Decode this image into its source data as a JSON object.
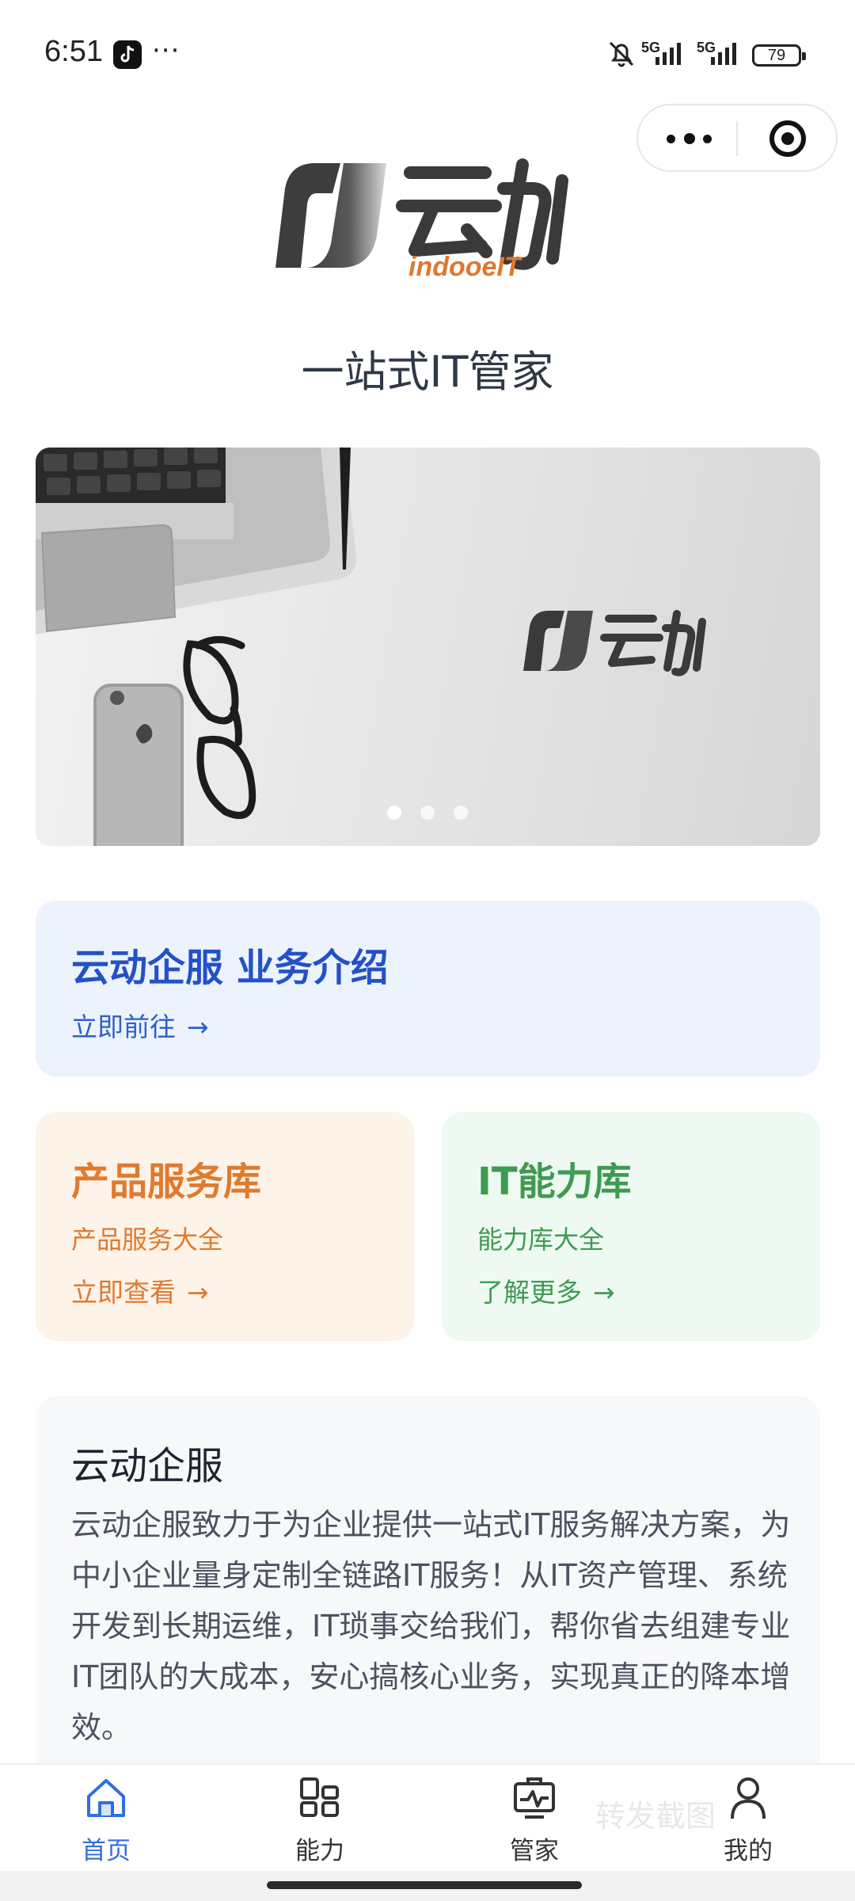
{
  "status_bar": {
    "time": "6:51",
    "overflow": "···",
    "network_1": "5G",
    "network_2": "5G",
    "battery": "79"
  },
  "header": {
    "logo_text": "云动",
    "logo_subtext": "indooeIT",
    "slogan": "一站式IT管家"
  },
  "banner": {
    "logo_text": "云动",
    "slides": 3,
    "active_slide": 0
  },
  "cards": {
    "intro": {
      "title": "云动企服 业务介绍",
      "link": "立即前往"
    },
    "product": {
      "title": "产品服务库",
      "subtitle": "产品服务大全",
      "link": "立即查看"
    },
    "it": {
      "title": "IT能力库",
      "subtitle": "能力库大全",
      "link": "了解更多"
    },
    "about": {
      "title": "云动企服",
      "body": "云动企服致力于为企业提供一站式IT服务解决方案，为中小企业量身定制全链路IT服务！从IT资产管理、系统开发到长期运维，IT琐事交给我们，帮你省去组建专业IT团队的大成本，安心搞核心业务，实现真正的降本增效。"
    }
  },
  "watermark": "转发截图",
  "tabbar": [
    {
      "label": "首页",
      "icon": "home-icon",
      "active": true
    },
    {
      "label": "能力",
      "icon": "grid-icon",
      "active": false
    },
    {
      "label": "管家",
      "icon": "monitor-icon",
      "active": false
    },
    {
      "label": "我的",
      "icon": "user-icon",
      "active": false
    }
  ],
  "colors": {
    "accent": "#2f6fe0",
    "intro_bg": "#ecf3fd",
    "product": "#df7a2e",
    "it": "#3f9a52"
  }
}
